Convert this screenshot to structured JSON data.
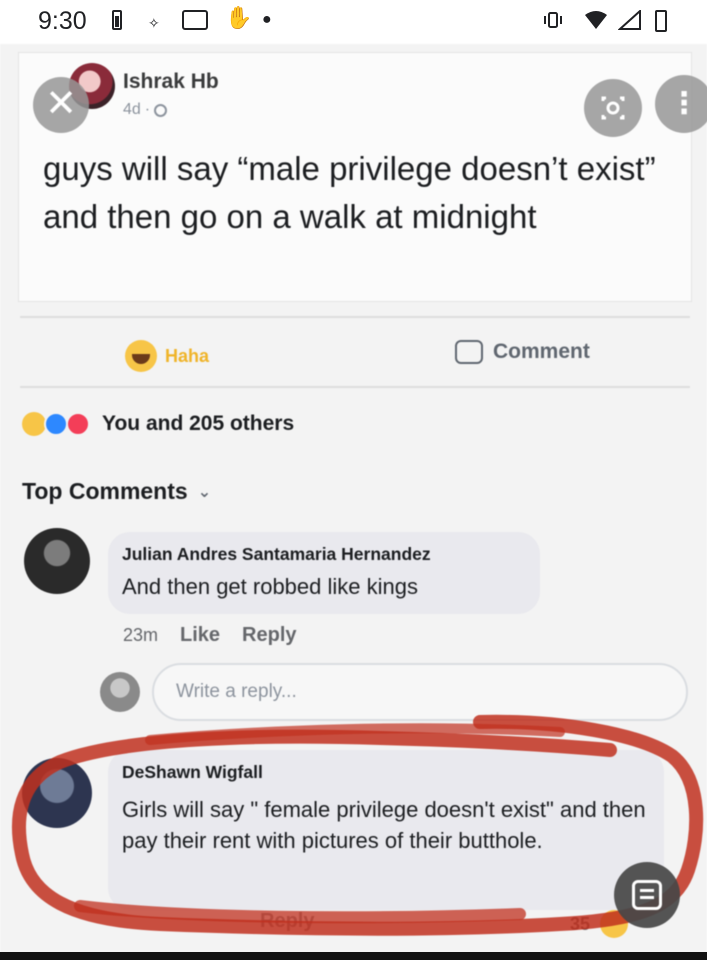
{
  "status_bar": {
    "time": "9:30"
  },
  "post": {
    "author": "Ishrak Hb",
    "age": "4d",
    "separator": "·",
    "text": "guys will say “male privilege doesn’t exist” and then go on a walk at midnight",
    "close_glyph": "✕",
    "more_glyph": "⋮"
  },
  "actions": {
    "haha_label": "Haha",
    "comment_label": "Comment"
  },
  "reactions": {
    "summary": "You and 205 others"
  },
  "comments_header": {
    "label": "Top Comments",
    "chevron": "⌄"
  },
  "comments": [
    {
      "author": "Julian Andres Santamaria Hernandez",
      "text": "And then get robbed like kings",
      "time": "23m",
      "like_label": "Like",
      "reply_label": "Reply"
    },
    {
      "author": "DeShawn Wigfall",
      "text": "Girls will say \" female privilege doesn't exist\" and then pay their rent with pictures of their butthole.",
      "reply_label": "Reply",
      "reaction_count": "35"
    }
  ],
  "reply_box": {
    "placeholder": "Write a reply..."
  },
  "colors": {
    "scribble": "#c0301f",
    "haha": "#f0b429",
    "like": "#2d88ff",
    "love": "#f33e58"
  },
  "icons": [
    "close-icon",
    "lens-icon",
    "more-icon",
    "globe-icon",
    "haha-emoji-icon",
    "comment-icon",
    "chevron-down-icon",
    "lens-fab-icon"
  ]
}
